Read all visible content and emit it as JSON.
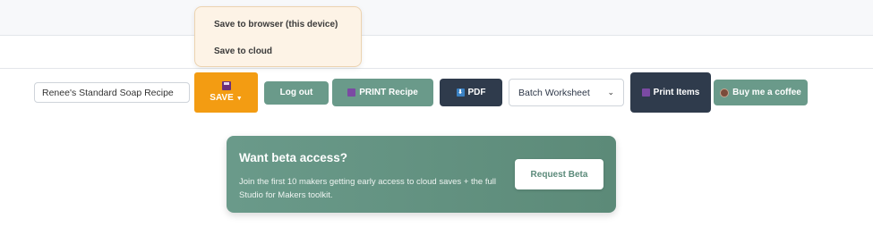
{
  "dropdown": {
    "items": [
      "Save to browser (this device)",
      "Save to cloud"
    ]
  },
  "toolbar": {
    "recipe_name_value": "Renee's Standard Soap Recipe",
    "save_label": "SAVE",
    "save_icon": "floppy-disk-icon",
    "logout_label": "Log out",
    "print_recipe_label": "PRINT Recipe",
    "pdf_label": "PDF",
    "batch_select_value": "Batch Worksheet",
    "print_items_label": "Print Items",
    "coffee_label": "Buy me a coffee"
  },
  "beta": {
    "title": "Want beta access?",
    "description": "Join the first 10 makers getting early access to cloud saves + the full Studio for Makers toolkit.",
    "button_label": "Request Beta"
  },
  "colors": {
    "save_orange": "#f39c12",
    "sage_green": "#6a9a8a",
    "dark_slate": "#2f3b4c",
    "dropdown_bg": "#fdf3e6"
  }
}
